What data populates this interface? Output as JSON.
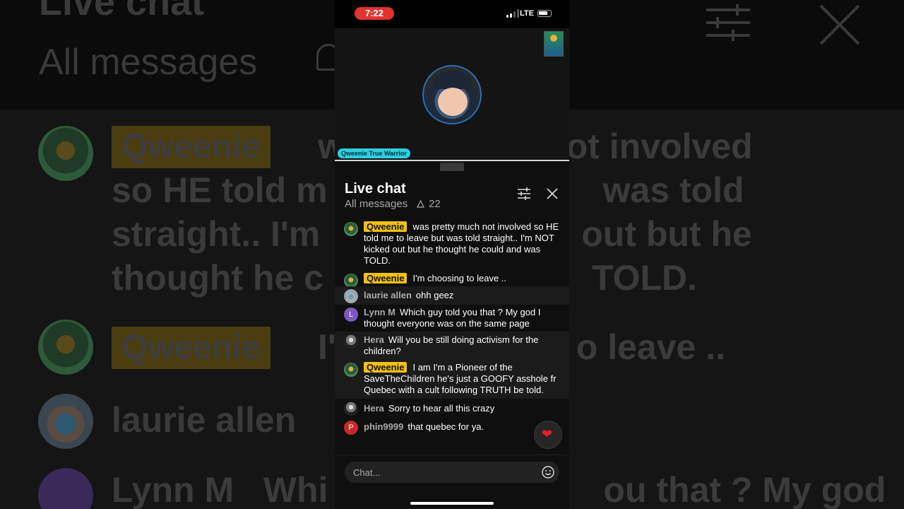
{
  "status_bar": {
    "time": "7:22",
    "network": "LTE"
  },
  "video": {
    "overlay_label": "Qweenie True Warrior"
  },
  "chat": {
    "title": "Live chat",
    "filter_label": "All messages",
    "viewer_count": "22",
    "input_placeholder": "Chat...",
    "messages": [
      {
        "author": "Qweenie",
        "owner": true,
        "text": "was pretty much not involved so HE told me to leave but was told straight.. I'm NOT kicked out but he thought he could and was TOLD."
      },
      {
        "author": "Qweenie",
        "owner": true,
        "text": "I'm choosing to leave .."
      },
      {
        "author": "laurie allen",
        "owner": false,
        "text": "ohh geez"
      },
      {
        "author": "Lynn M",
        "owner": false,
        "avatar_letter": "L",
        "text": "Which guy told you that ? My god I thought everyone was on the same page"
      },
      {
        "author": "Hera",
        "owner": false,
        "text": "Will you be still doing activism for the children?"
      },
      {
        "author": "Qweenie",
        "owner": true,
        "text": "I am I'm a Pioneer of the SaveTheChildren he's just a GOOFY asshole fr Quebec with a cult following TRUTH be told."
      },
      {
        "author": "Hera",
        "owner": false,
        "text": "Sorry to hear all this crazy"
      },
      {
        "author": "phin9999",
        "owner": false,
        "avatar_letter": "P",
        "text": "that quebec for ya."
      }
    ]
  },
  "colors": {
    "owner_badge": "#f3c10f",
    "live_pill": "#e0342f",
    "overlay_badge": "#2ecfe0"
  },
  "icons": [
    "tune-icon",
    "close-icon",
    "person-icon",
    "heart-icon",
    "emoji-icon"
  ]
}
